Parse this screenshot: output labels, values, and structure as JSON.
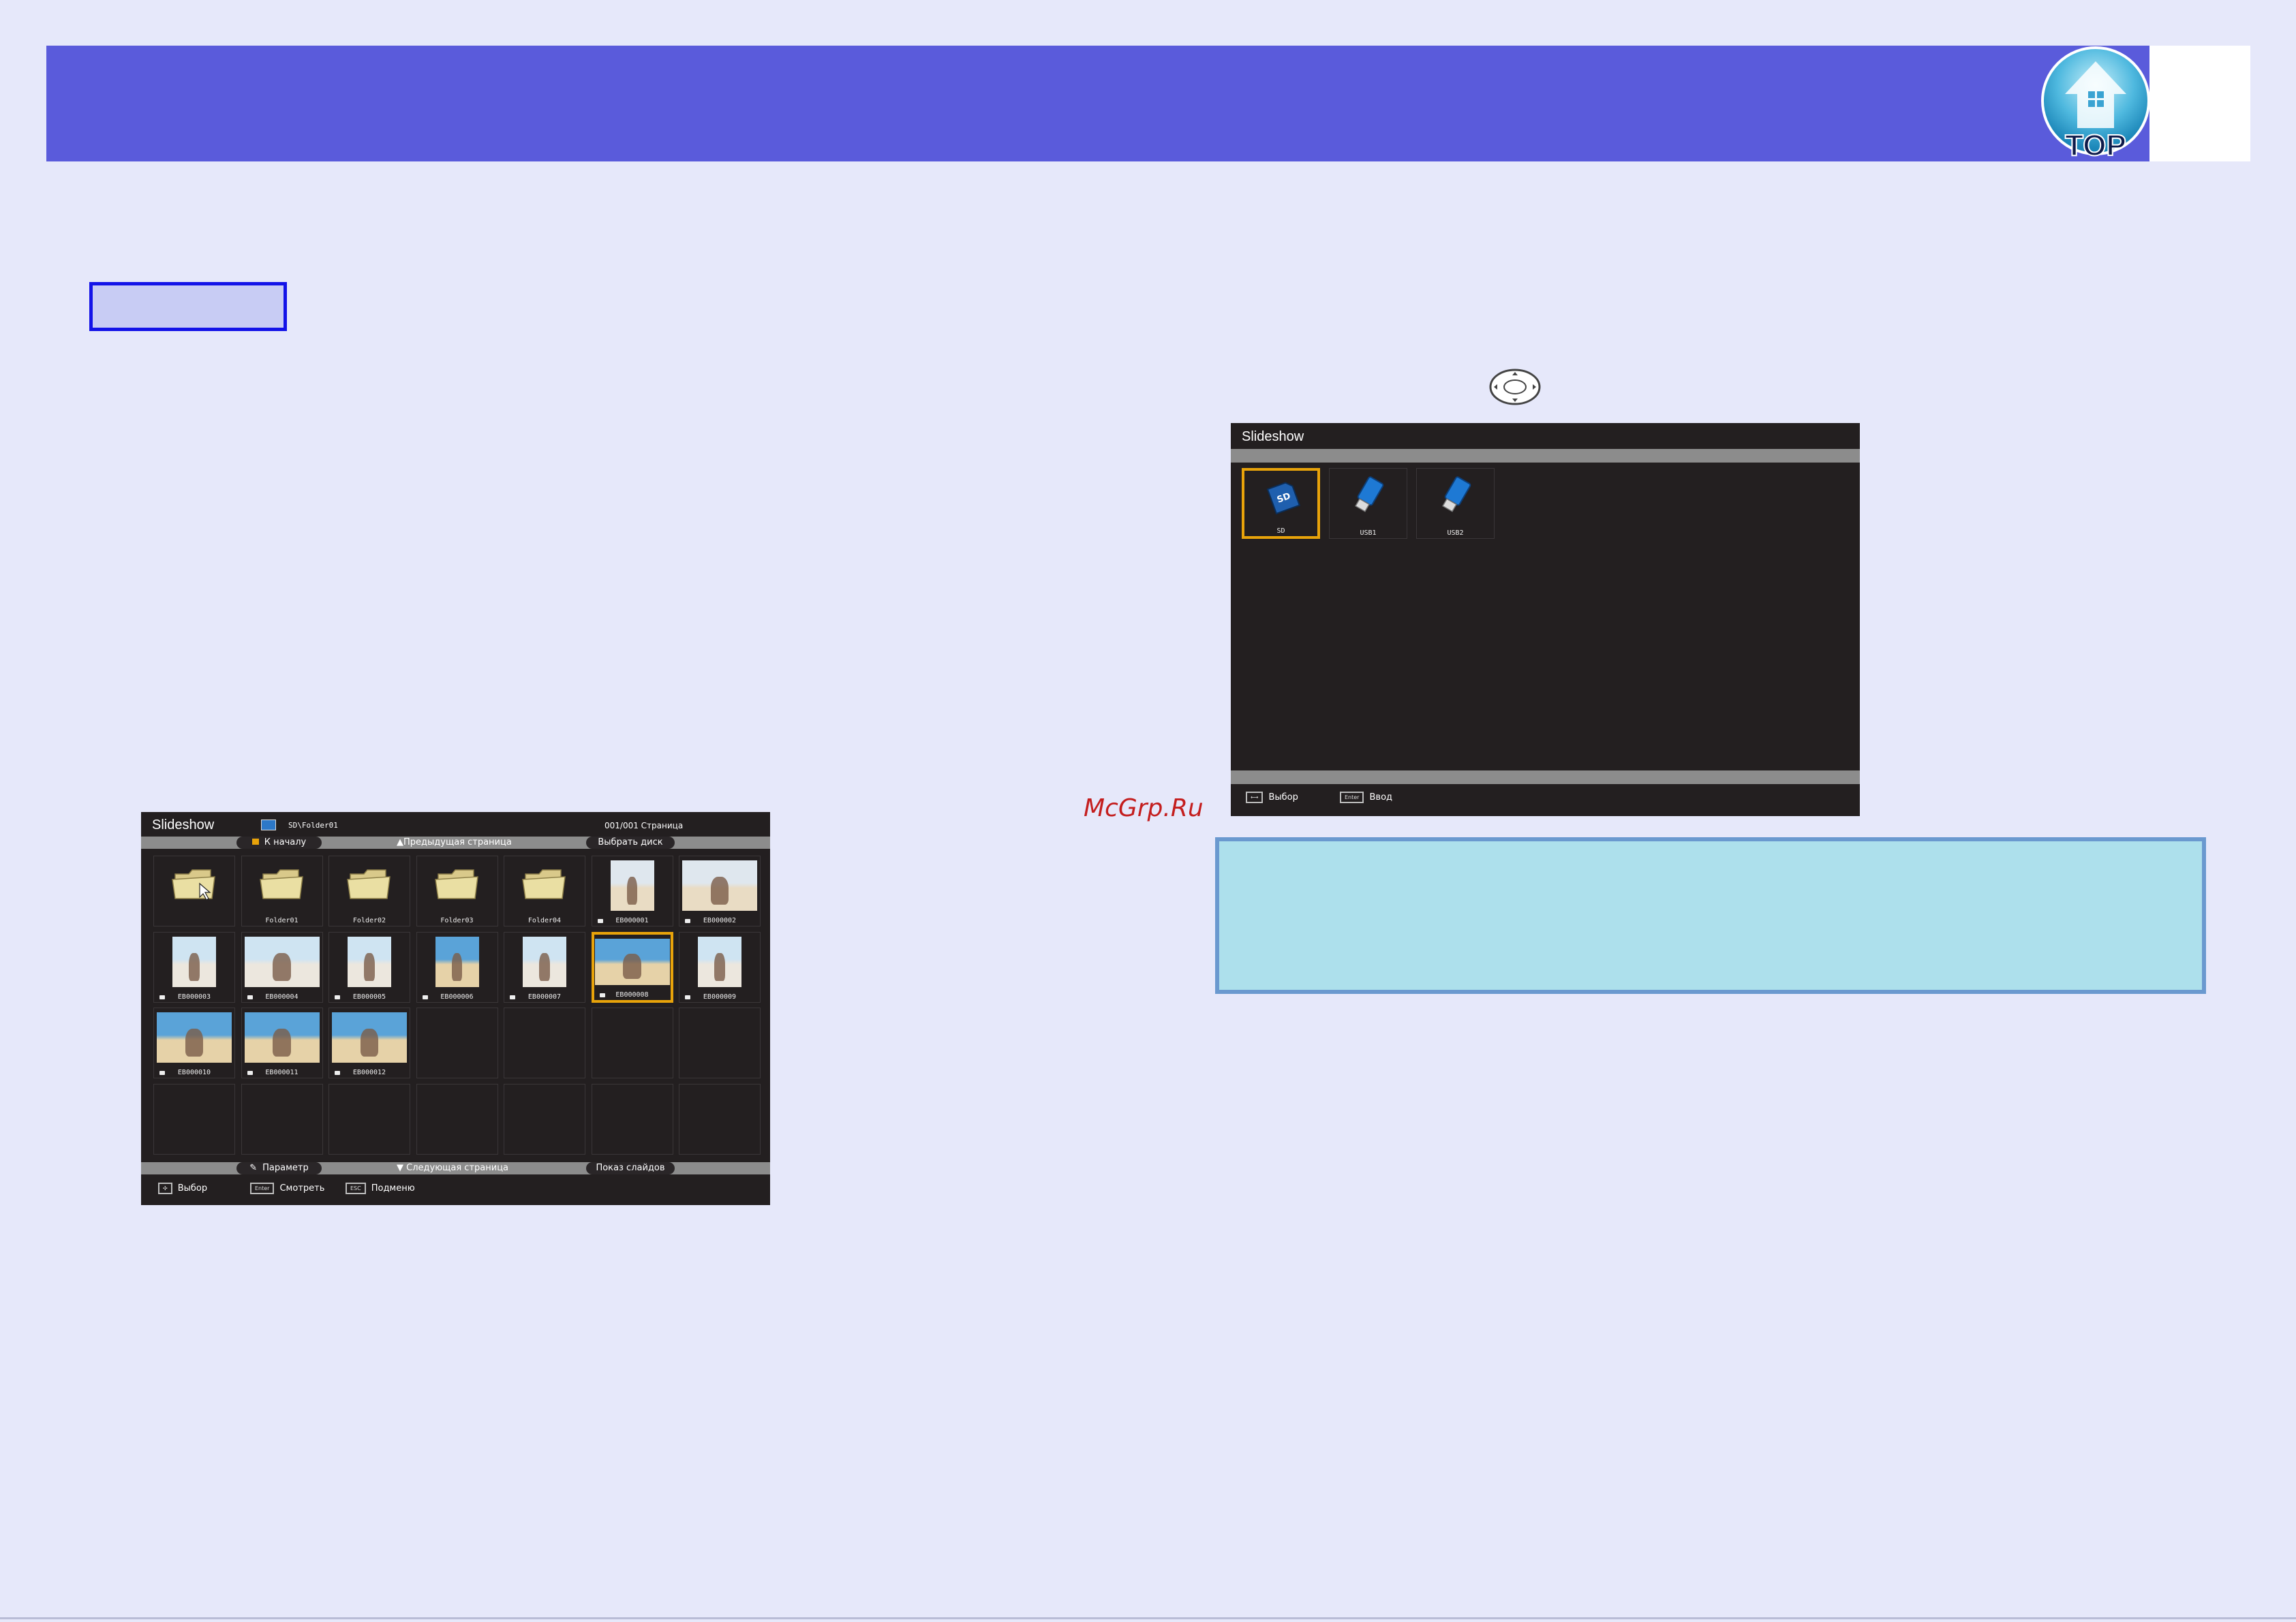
{
  "header": {
    "logo_text": "TOP"
  },
  "watermark": "McGrp.Ru",
  "left_screen": {
    "title": "Slideshow",
    "path": "SD\\Folder01",
    "page_indicator": "001/001 Страница",
    "top_bar": {
      "home": "К началу",
      "prev_page": "▲Предыдущая страница",
      "select_disk": "Выбрать диск"
    },
    "bottom_bar": {
      "option": "Параметр",
      "next_page": "▼ Следующая страница",
      "slideshow": "Показ слайдов"
    },
    "footer": {
      "select": "Выбор",
      "view": "Смотреть",
      "view_key": "Enter",
      "menu": "Подменю",
      "menu_key": "ESC"
    },
    "rows": [
      [
        {
          "type": "folder",
          "label": "",
          "cursor": true
        },
        {
          "type": "folder",
          "label": "Folder01"
        },
        {
          "type": "folder",
          "label": "Folder02"
        },
        {
          "type": "folder",
          "label": "Folder03"
        },
        {
          "type": "folder",
          "label": "Folder04"
        },
        {
          "type": "photo",
          "label": "EB000001",
          "cam": true,
          "orient": "portrait",
          "scene": "sand"
        },
        {
          "type": "photo",
          "label": "EB000002",
          "cam": true,
          "orient": "landscape",
          "scene": "sand"
        }
      ],
      [
        {
          "type": "photo",
          "label": "EB000003",
          "cam": true,
          "orient": "portrait",
          "scene": "people"
        },
        {
          "type": "photo",
          "label": "EB000004",
          "cam": true,
          "orient": "landscape",
          "scene": "people"
        },
        {
          "type": "photo",
          "label": "EB000005",
          "cam": true,
          "orient": "portrait",
          "scene": "people"
        },
        {
          "type": "photo",
          "label": "EB000006",
          "cam": true,
          "orient": "portrait",
          "scene": "sea"
        },
        {
          "type": "photo",
          "label": "EB000007",
          "cam": true,
          "orient": "portrait",
          "scene": "people"
        },
        {
          "type": "photo",
          "label": "EB000008",
          "cam": true,
          "orient": "landscape",
          "scene": "sea",
          "selected": true
        },
        {
          "type": "photo",
          "label": "EB000009",
          "cam": true,
          "orient": "portrait",
          "scene": "people"
        }
      ],
      [
        {
          "type": "photo",
          "label": "EB000010",
          "cam": true,
          "orient": "landscape",
          "scene": "sea"
        },
        {
          "type": "photo",
          "label": "EB000011",
          "cam": true,
          "orient": "landscape",
          "scene": "sea"
        },
        {
          "type": "photo",
          "label": "EB000012",
          "cam": true,
          "orient": "landscape",
          "scene": "sea"
        },
        {
          "type": "empty"
        },
        {
          "type": "empty"
        },
        {
          "type": "empty"
        },
        {
          "type": "empty"
        }
      ],
      [
        {
          "type": "empty"
        },
        {
          "type": "empty"
        },
        {
          "type": "empty"
        },
        {
          "type": "empty"
        },
        {
          "type": "empty"
        },
        {
          "type": "empty"
        },
        {
          "type": "empty"
        }
      ]
    ]
  },
  "right_screen": {
    "title": "Slideshow",
    "devices": [
      {
        "label": "SD",
        "kind": "sd",
        "selected": true
      },
      {
        "label": "USB1",
        "kind": "usb"
      },
      {
        "label": "USB2",
        "kind": "usb"
      }
    ],
    "footer": {
      "select": "Выбор",
      "enter": "Ввод",
      "enter_key": "Enter"
    }
  },
  "colors": {
    "header": "#5a5bdb",
    "selection": "#e8a30a",
    "note_bg": "#ade0ec",
    "note_border": "#6a99cf",
    "tag_border": "#1313e8"
  }
}
